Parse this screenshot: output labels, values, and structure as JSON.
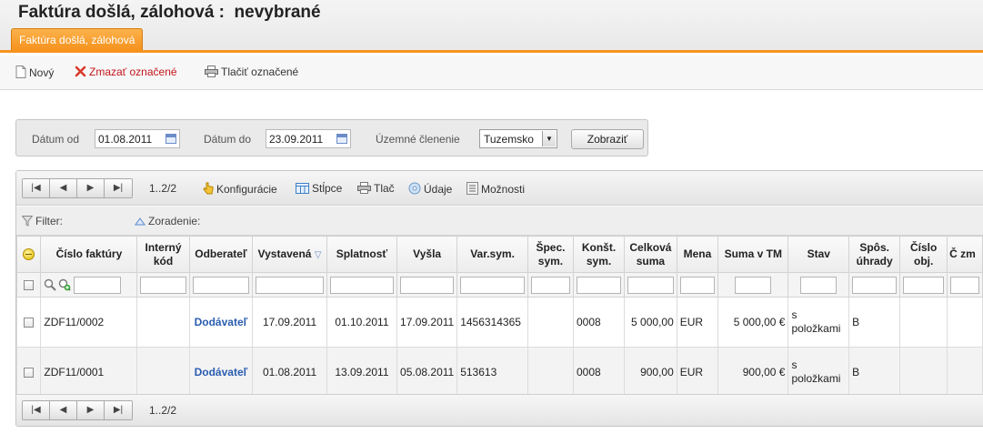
{
  "page": {
    "title": "Faktúra došlá, zálohová :  nevybrané"
  },
  "tabs": [
    {
      "label": "Faktúra došlá, zálohová",
      "active": true
    }
  ],
  "toolbar": {
    "new_label": "Nový",
    "delete_label": "Zmazať označené",
    "print_label": "Tlačiť označené"
  },
  "filter": {
    "date_from_label": "Dátum od",
    "date_from_value": "01.08.2011",
    "date_to_label": "Dátum do",
    "date_to_value": "23.09.2011",
    "territory_label": "Územné členenie",
    "territory_value": "Tuzemsko",
    "show_button": "Zobraziť"
  },
  "grid": {
    "pager_info": "1..2/2",
    "tools": {
      "config": "Konfigurácie",
      "columns": "Stĺpce",
      "print": "Tlač",
      "data": "Údaje",
      "options": "Možnosti"
    },
    "filter_label": "Filter:",
    "sort_label": "Zoradenie:",
    "columns": [
      "Číslo faktúry",
      "Interný kód",
      "Odberateľ",
      "Vystavená",
      "Splatnosť",
      "Vyšla",
      "Var.sym.",
      "Špec. sym.",
      "Konšt. sym.",
      "Celková suma",
      "Mena",
      "Suma v TM",
      "Stav",
      "Spôs. úhrady",
      "Číslo obj.",
      "Č zm"
    ],
    "rows": [
      {
        "cislo": "ZDF11/0002",
        "interny": "",
        "odberatel": "Dodávateľ",
        "vystavena": "17.09.2011",
        "splatnost": "01.10.2011",
        "vysla": "17.09.2011",
        "varsym": "1456314365",
        "specsym": "",
        "konstsym": "0008",
        "celkova": "5 000,00",
        "mena": "EUR",
        "suma_tm": "5 000,00 €",
        "stav": "s položkami",
        "sposob": "B",
        "cislo_obj": ""
      },
      {
        "cislo": "ZDF11/0001",
        "interny": "",
        "odberatel": "Dodávateľ",
        "vystavena": "01.08.2011",
        "splatnost": "13.09.2011",
        "vysla": "05.08.2011",
        "varsym": "513613",
        "specsym": "",
        "konstsym": "0008",
        "celkova": "900,00",
        "mena": "EUR",
        "suma_tm": "900,00 €",
        "stav": "s položkami",
        "sposob": "B",
        "cislo_obj": ""
      }
    ]
  },
  "colors": {
    "accent": "#f6931f",
    "link": "#2a5db0",
    "delete": "#c4161c"
  }
}
